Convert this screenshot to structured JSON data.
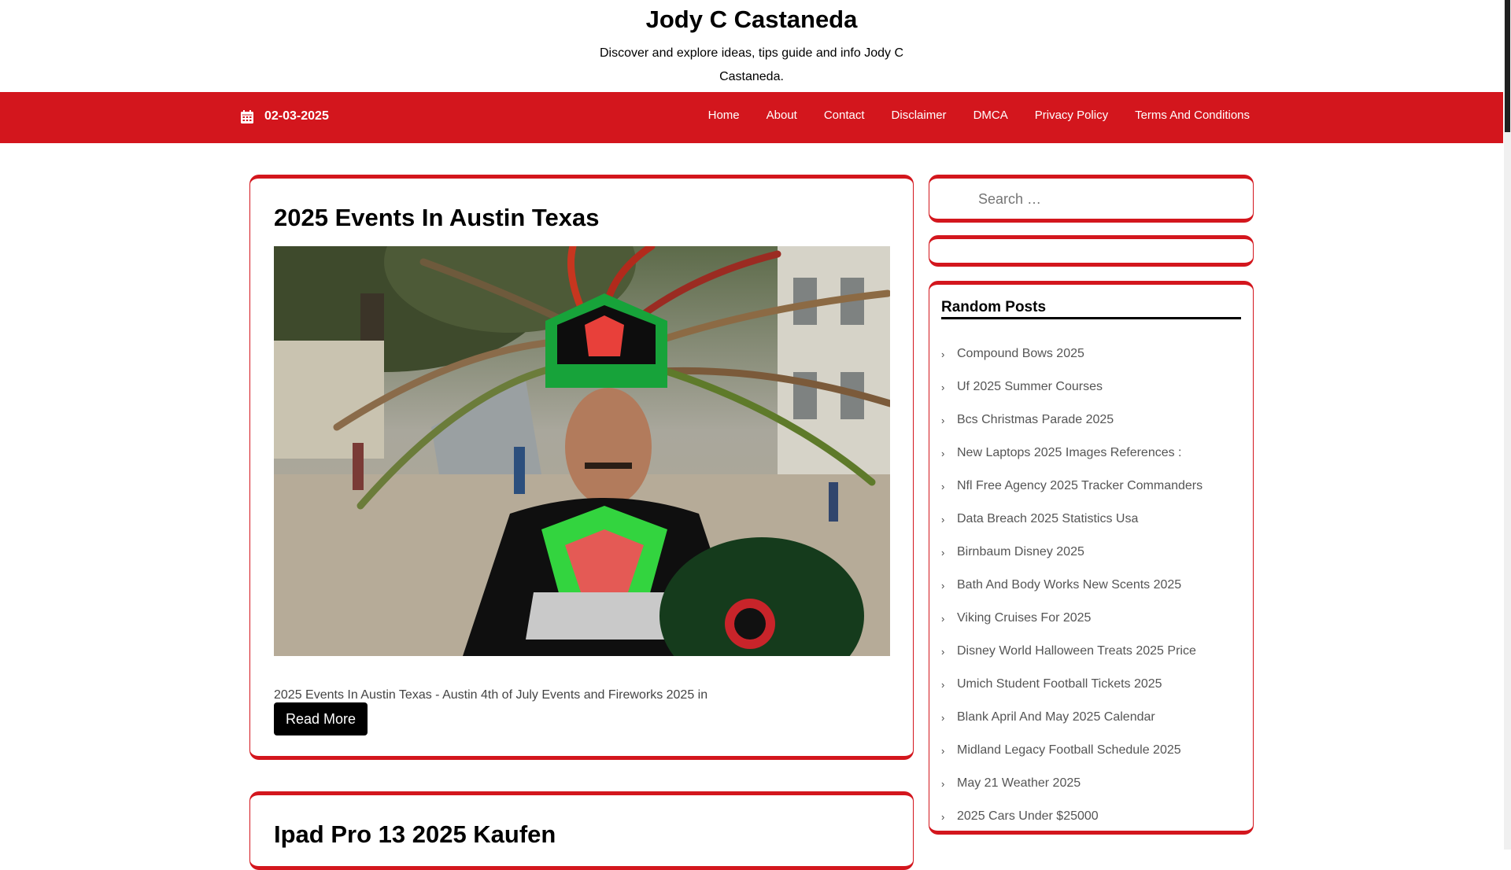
{
  "site": {
    "title": "Jody C Castaneda",
    "tagline": "Discover and explore ideas, tips guide and info Jody C Castaneda."
  },
  "topbar": {
    "date": "02-03-2025",
    "icon": "calendar-icon",
    "nav": [
      "Home",
      "About",
      "Contact",
      "Disclaimer",
      "DMCA",
      "Privacy Policy",
      "Terms And Conditions"
    ],
    "color": "#d3161d"
  },
  "posts": [
    {
      "title": "2025 Events In Austin Texas",
      "excerpt": "2025 Events In Austin Texas - Austin 4th of July Events and Fireworks 2025 in",
      "read_more": "Read More"
    },
    {
      "title": "Ipad Pro 13 2025 Kaufen"
    }
  ],
  "search": {
    "placeholder": "Search …"
  },
  "random_posts": {
    "title": "Random Posts",
    "items": [
      "Compound Bows 2025",
      "Uf 2025 Summer Courses",
      "Bcs Christmas Parade 2025",
      "New Laptops 2025 Images References :",
      "Nfl Free Agency 2025 Tracker Commanders",
      "Data Breach 2025 Statistics Usa",
      "Birnbaum Disney 2025",
      "Bath And Body Works New Scents 2025",
      "Viking Cruises For 2025",
      "Disney World Halloween Treats 2025 Price",
      "Umich Student Football Tickets 2025",
      "Blank April And May 2025 Calendar",
      "Midland Legacy Football Schedule 2025",
      "May 21 Weather 2025",
      "2025 Cars Under $25000"
    ]
  }
}
